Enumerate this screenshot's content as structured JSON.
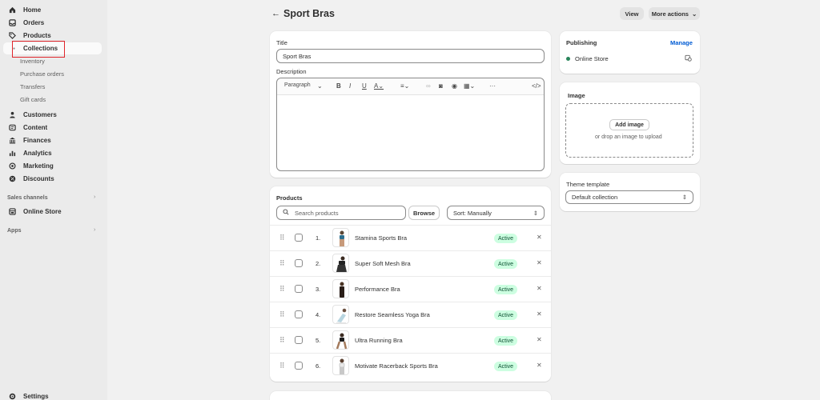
{
  "sidebar": {
    "items": [
      {
        "label": "Home",
        "icon": "home-icon"
      },
      {
        "label": "Orders",
        "icon": "inbox-icon"
      },
      {
        "label": "Products",
        "icon": "tag-icon"
      },
      {
        "label": "Collections",
        "icon": "dot-icon"
      },
      {
        "label": "Customers",
        "icon": "person-icon"
      },
      {
        "label": "Content",
        "icon": "content-icon"
      },
      {
        "label": "Finances",
        "icon": "bank-icon"
      },
      {
        "label": "Analytics",
        "icon": "bar-chart-icon"
      },
      {
        "label": "Marketing",
        "icon": "target-icon"
      },
      {
        "label": "Discounts",
        "icon": "discount-icon"
      }
    ],
    "sub_items": [
      "Inventory",
      "Purchase orders",
      "Transfers",
      "Gift cards"
    ],
    "sales_channels_label": "Sales channels",
    "online_store_label": "Online Store",
    "apps_label": "Apps",
    "settings_label": "Settings"
  },
  "header": {
    "back_glyph": "←",
    "title": "Sport Bras",
    "view_label": "View",
    "more_actions_label": "More actions"
  },
  "details": {
    "title_label": "Title",
    "title_value": "Sport Bras",
    "description_label": "Description",
    "paragraph_label": "Paragraph"
  },
  "products": {
    "heading": "Products",
    "search_placeholder": "Search products",
    "browse_label": "Browse",
    "sort_label": "Sort: Manually",
    "rows": [
      {
        "index": "1.",
        "name": "Stamina Sports Bra",
        "status": "Active"
      },
      {
        "index": "2.",
        "name": "Super Soft Mesh Bra",
        "status": "Active"
      },
      {
        "index": "3.",
        "name": "Performance Bra",
        "status": "Active"
      },
      {
        "index": "4.",
        "name": "Restore Seamless Yoga Bra",
        "status": "Active"
      },
      {
        "index": "5.",
        "name": "Ultra Running Bra",
        "status": "Active"
      },
      {
        "index": "6.",
        "name": "Motivate Racerback Sports Bra",
        "status": "Active"
      }
    ]
  },
  "publishing": {
    "heading": "Publishing",
    "manage_label": "Manage",
    "channel": "Online Store",
    "status_color": "#29845a"
  },
  "image": {
    "heading": "Image",
    "add_label": "Add image",
    "drop_hint": "or drop an image to upload"
  },
  "theme": {
    "label": "Theme template",
    "value": "Default collection"
  },
  "colors": {
    "accent": "#005bd3",
    "active_badge_bg": "#cdfee1",
    "highlight": "#e0252b"
  }
}
